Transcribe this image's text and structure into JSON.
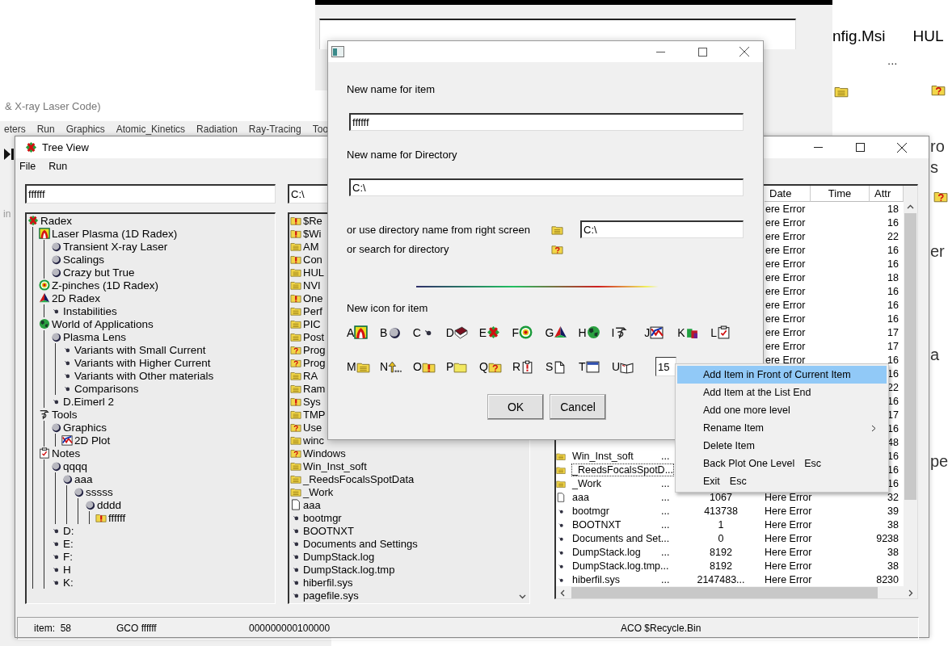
{
  "right_window": {
    "top_texts": [
      "nfig.Msi",
      "HUL",
      "..."
    ],
    "edge_texts": [
      "ro",
      "s",
      "er",
      "a",
      "pe"
    ]
  },
  "main_window": {
    "title": "& X-ray Laser Code)",
    "menu": [
      "eters",
      "Run",
      "Graphics",
      "Atomic_Kinetics",
      "Radiation",
      "Ray-Tracing",
      "Too"
    ],
    "side_text": "in"
  },
  "tree_view": {
    "title": "Tree View",
    "menu": [
      "File",
      "Run"
    ],
    "tree_filter": "ffffff",
    "tree": [
      {
        "label": "Radex",
        "kind": "radex",
        "children": [
          {
            "label": "Laser Plasma (1D Radex)",
            "kind": "plasma",
            "children": [
              {
                "label": "Transient X-ray Laser",
                "kind": "ball"
              },
              {
                "label": "Scalings",
                "kind": "ball"
              },
              {
                "label": "Crazy but True",
                "kind": "ball"
              }
            ]
          },
          {
            "label": "Z-pinches (1D Radex)",
            "kind": "target"
          },
          {
            "label": "2D Radex",
            "kind": "pyramid",
            "children": [
              {
                "label": "Instabilities",
                "kind": "dot"
              }
            ]
          },
          {
            "label": "World of Applications",
            "kind": "globe",
            "children": [
              {
                "label": "Plasma Lens",
                "kind": "ball",
                "children": [
                  {
                    "label": "Variants with Small Current",
                    "kind": "dot"
                  },
                  {
                    "label": "Variants with Higher Current",
                    "kind": "dot"
                  },
                  {
                    "label": "Variants with Other materials",
                    "kind": "dot"
                  },
                  {
                    "label": "Comparisons",
                    "kind": "dot"
                  }
                ]
              },
              {
                "label": "D.Eimerl 2",
                "kind": "dot"
              }
            ]
          },
          {
            "label": "Tools",
            "kind": "tools",
            "children": [
              {
                "label": "Graphics",
                "kind": "ball",
                "children": [
                  {
                    "label": "2D Plot",
                    "kind": "plot"
                  }
                ]
              }
            ]
          },
          {
            "label": "Notes",
            "kind": "notes",
            "children": [
              {
                "label": "qqqq",
                "kind": "ball",
                "children": [
                  {
                    "label": "aaa",
                    "kind": "ball",
                    "children": [
                      {
                        "label": "sssss",
                        "kind": "ball",
                        "children": [
                          {
                            "label": "dddd",
                            "kind": "ball",
                            "children": [
                              {
                                "label": "ffffff",
                                "kind": "folder_alert"
                              }
                            ]
                          }
                        ]
                      }
                    ]
                  }
                ]
              },
              {
                "label": "D:",
                "kind": "dot"
              },
              {
                "label": "E:",
                "kind": "dot"
              },
              {
                "label": "F:",
                "kind": "dot"
              },
              {
                "label": "H",
                "kind": "dot"
              },
              {
                "label": "K:",
                "kind": "dot"
              }
            ]
          }
        ]
      }
    ],
    "dir_field": "C:\\",
    "dir_list": [
      {
        "name": "$Re",
        "kind": "folder_alert"
      },
      {
        "name": "$Wi",
        "kind": "folder_alert"
      },
      {
        "name": "AM",
        "kind": "folder"
      },
      {
        "name": "Con",
        "kind": "folder_alert"
      },
      {
        "name": "HUL",
        "kind": "folder"
      },
      {
        "name": "NVI",
        "kind": "folder"
      },
      {
        "name": "One",
        "kind": "folder_alert"
      },
      {
        "name": "Perf",
        "kind": "folder"
      },
      {
        "name": "PIC",
        "kind": "folder"
      },
      {
        "name": "Post",
        "kind": "folder"
      },
      {
        "name": "Prog",
        "kind": "folder_question"
      },
      {
        "name": "Prog",
        "kind": "folder_question"
      },
      {
        "name": "RA",
        "kind": "folder"
      },
      {
        "name": "Ram",
        "kind": "folder"
      },
      {
        "name": "Sys",
        "kind": "folder_alert"
      },
      {
        "name": "TMP",
        "kind": "folder"
      },
      {
        "name": "Use",
        "kind": "folder_question"
      },
      {
        "name": "winc",
        "kind": "folder"
      },
      {
        "name": "Windows",
        "kind": "folder_question"
      },
      {
        "name": "Win_Inst_soft",
        "kind": "folder"
      },
      {
        "name": "_ReedsFocalsSpotData",
        "kind": "folder"
      },
      {
        "name": "_Work",
        "kind": "folder"
      },
      {
        "name": "aaa",
        "kind": "file"
      },
      {
        "name": "bootmgr",
        "kind": "dot"
      },
      {
        "name": "BOOTNXT",
        "kind": "dot"
      },
      {
        "name": "Documents and Settings",
        "kind": "dot"
      },
      {
        "name": "DumpStack.log",
        "kind": "dot"
      },
      {
        "name": "DumpStack.log.tmp",
        "kind": "dot"
      },
      {
        "name": "hiberfil.sys",
        "kind": "dot"
      },
      {
        "name": "pagefile.sys",
        "kind": "dot"
      }
    ],
    "file_list": {
      "columns": [
        "Date",
        "Time",
        "Attr"
      ],
      "rows": [
        {
          "date": "ere Error",
          "attr": "18"
        },
        {
          "date": "ere Error",
          "attr": "16"
        },
        {
          "date": "ere Error",
          "attr": "22"
        },
        {
          "date": "ere Error",
          "attr": "16"
        },
        {
          "date": "ere Error",
          "attr": "16"
        },
        {
          "date": "ere Error",
          "attr": "18"
        },
        {
          "date": "ere Error",
          "attr": "16"
        },
        {
          "date": "ere Error",
          "attr": "16"
        },
        {
          "date": "ere Error",
          "attr": "16"
        },
        {
          "date": "ere Error",
          "attr": "17"
        },
        {
          "date": "ere Error",
          "attr": "17"
        },
        {
          "date": "ere Error",
          "attr": "16"
        },
        {
          "attr": "16"
        },
        {
          "attr": "22"
        },
        {
          "attr": "16"
        },
        {
          "attr": "17"
        },
        {
          "attr": "16"
        },
        {
          "attr": "48"
        },
        {
          "kind": "folder",
          "name": "Win_Inst_soft",
          "dots": "...",
          "attr": "16"
        },
        {
          "kind": "folder",
          "name": "_ReedsFocalsSpotD...",
          "focused": true,
          "attr": "16"
        },
        {
          "kind": "folder",
          "name": "_Work",
          "dots": "...",
          "attr": "16"
        },
        {
          "kind": "file",
          "name": "aaa",
          "dots": "...",
          "size": "1067",
          "date": "Here Error",
          "attr": "32"
        },
        {
          "kind": "dot",
          "name": "bootmgr",
          "dots": "...",
          "size": "413738",
          "date": "Here Error",
          "attr": "39"
        },
        {
          "kind": "dot",
          "name": "BOOTNXT",
          "dots": "...",
          "size": "1",
          "date": "Here Error",
          "attr": "38"
        },
        {
          "kind": "dot",
          "name": "Documents and Set...",
          "size": "0",
          "date": "Here Error",
          "attr": "9238"
        },
        {
          "kind": "dot",
          "name": "DumpStack.log",
          "dots": "...",
          "size": "8192",
          "date": "Here Error",
          "attr": "38"
        },
        {
          "kind": "dot",
          "name": "DumpStack.log.tmp...",
          "size": "8192",
          "date": "Here Error",
          "attr": "38"
        },
        {
          "kind": "dot",
          "name": "hiberfil.sys",
          "dots": "...",
          "size": "2147483...",
          "date": "Here Error",
          "attr": "8230"
        }
      ]
    },
    "status_bar": [
      "item:  58",
      "GCO ffffff",
      "000000000100000",
      "ACO $Recycle.Bin"
    ]
  },
  "dialog": {
    "item_label": "New name for item",
    "item_value": "ffffff",
    "dir_label": "New name for Directory",
    "dir_value": "C:\\",
    "right_label": "or use directory name from right screen",
    "right_value": "C:\\",
    "search_label": "or search for directory",
    "icon_label": "New icon for item",
    "icon_rows": [
      [
        {
          "letter": "A",
          "kind": "plasma"
        },
        {
          "letter": "B",
          "kind": "ball"
        },
        {
          "letter": "C",
          "kind": "dot"
        },
        {
          "letter": "D",
          "kind": "book"
        },
        {
          "letter": "E",
          "kind": "radex"
        },
        {
          "letter": "F",
          "kind": "target"
        },
        {
          "letter": "G",
          "kind": "pyramid"
        },
        {
          "letter": "H",
          "kind": "globe"
        },
        {
          "letter": "I",
          "kind": "tools"
        },
        {
          "letter": "J",
          "kind": "plot"
        },
        {
          "letter": "K",
          "kind": "bag"
        },
        {
          "letter": "L",
          "kind": "notes"
        }
      ],
      [
        {
          "letter": "M",
          "kind": "folder"
        },
        {
          "letter": "N",
          "kind": "arrow"
        },
        {
          "letter": "O",
          "kind": "folder_alert"
        },
        {
          "letter": "P",
          "kind": "folder_plain"
        },
        {
          "letter": "Q",
          "kind": "folder_question"
        },
        {
          "letter": "R",
          "kind": "clipboard_alert"
        },
        {
          "letter": "S",
          "kind": "page"
        },
        {
          "letter": "T",
          "kind": "window"
        },
        {
          "letter": "U",
          "kind": "open_book"
        }
      ]
    ],
    "icon_number": "15",
    "buttons": [
      "OK",
      "Cancel"
    ]
  },
  "context_menu": {
    "items": [
      {
        "label": "Add Item in Front of Current Item",
        "selected": true
      },
      {
        "label": "Add Item at the List End",
        "selected": false
      },
      {
        "label": "Add one more level",
        "selected": false
      },
      {
        "label": "Rename Item",
        "submenu": true,
        "selected": false
      },
      {
        "label": "Delete Item",
        "selected": false
      },
      {
        "label": "Back Plot One Level",
        "shortcut": "Esc",
        "selected": false
      },
      {
        "label": "Exit",
        "shortcut": "Esc",
        "selected": false
      }
    ]
  }
}
